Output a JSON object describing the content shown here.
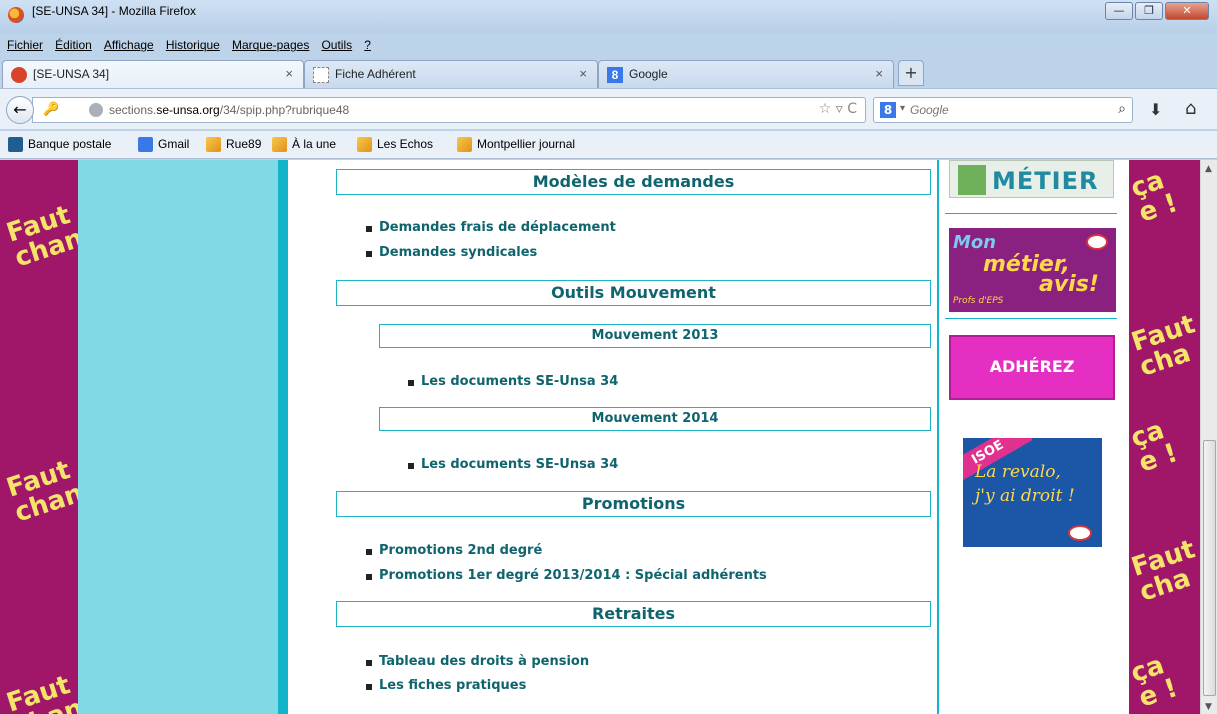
{
  "window": {
    "title": "[SE-UNSA 34] - Mozilla Firefox",
    "controls": {
      "minimize": "—",
      "maximize": "❐",
      "close": "✕"
    }
  },
  "menu": [
    "Fichier",
    "Édition",
    "Affichage",
    "Historique",
    "Marque-pages",
    "Outils",
    "?"
  ],
  "tabs": [
    {
      "label": "[SE-UNSA 34]",
      "active": true,
      "close": "×"
    },
    {
      "label": "Fiche Adhérent",
      "active": false,
      "close": "×"
    },
    {
      "label": "Google",
      "active": false,
      "close": "×"
    }
  ],
  "newtab": "+",
  "nav": {
    "back": "←",
    "url_prefix": "sections.",
    "url_domain": "se-unsa.org",
    "url_path": "/34/spip.php?rubrique48",
    "url_controls": "☆ ▿ C",
    "search_placeholder": "Google",
    "search_icon": "⌕",
    "download": "⬇",
    "home": "⌂"
  },
  "bookmarks": [
    "Banque postale",
    "Gmail",
    "Rue89",
    "À la une",
    "Les Echos",
    "Montpellier journal"
  ],
  "sections": [
    {
      "title": "Modèles de demandes",
      "items": [
        "Demandes frais de déplacement",
        "Demandes syndicales"
      ]
    },
    {
      "title": "Outils Mouvement",
      "subsections": [
        {
          "title": "Mouvement 2013",
          "items": [
            "Les documents SE-Unsa 34"
          ]
        },
        {
          "title": "Mouvement 2014",
          "items": [
            "Les documents SE-Unsa 34"
          ]
        }
      ]
    },
    {
      "title": "Promotions",
      "items": [
        "Promotions 2nd degré",
        "Promotions 1er degré 2013/2014 : Spécial adhérents"
      ]
    },
    {
      "title": "Retraites",
      "items": [
        "Tableau des droits à pension",
        "Les fiches pratiques"
      ]
    }
  ],
  "banners": {
    "metier": "MÉTIER",
    "avis": {
      "line1": "Mon",
      "line2": "métier,",
      "line3": "avis!",
      "line4": "Profs d'EPS"
    },
    "adherez": "ADHÉREZ",
    "isoe": {
      "band": "ISOE",
      "line1": "La revalo,",
      "line2": "j'y ai droit !"
    }
  },
  "slogans": {
    "left": "Faut\nchan",
    "right_a": "ça\ne !",
    "right_b": "Faut\ncha"
  },
  "colors": {
    "magenta": "#a0176a",
    "cyan": "#81d9e6",
    "teal_text": "#10646e",
    "accent_line": "#13b4c9"
  }
}
